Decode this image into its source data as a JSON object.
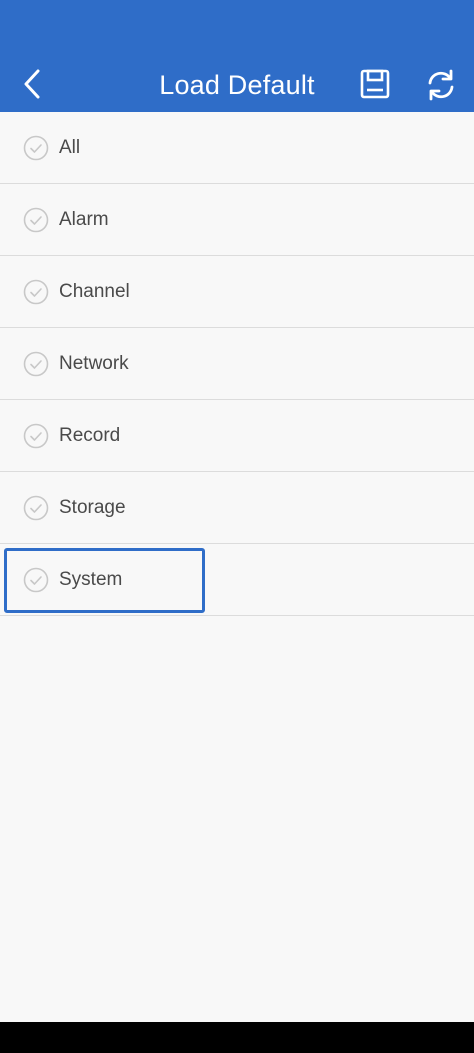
{
  "header": {
    "title": "Load Default",
    "back_icon": "chevron-left-icon",
    "save_icon": "floppy-disk-icon",
    "refresh_icon": "refresh-icon"
  },
  "colors": {
    "header_bg": "#2f6dc8",
    "list_bg": "#f8f8f8",
    "divider": "#dcdcdc",
    "text": "#4a4a4a",
    "check_circle": "#c8c8c8",
    "highlight": "#2f6dc8"
  },
  "items": [
    {
      "label": "All",
      "checked": false
    },
    {
      "label": "Alarm",
      "checked": false
    },
    {
      "label": "Channel",
      "checked": false
    },
    {
      "label": "Network",
      "checked": false
    },
    {
      "label": "Record",
      "checked": false
    },
    {
      "label": "Storage",
      "checked": false
    },
    {
      "label": "System",
      "checked": false,
      "highlighted": true
    }
  ]
}
